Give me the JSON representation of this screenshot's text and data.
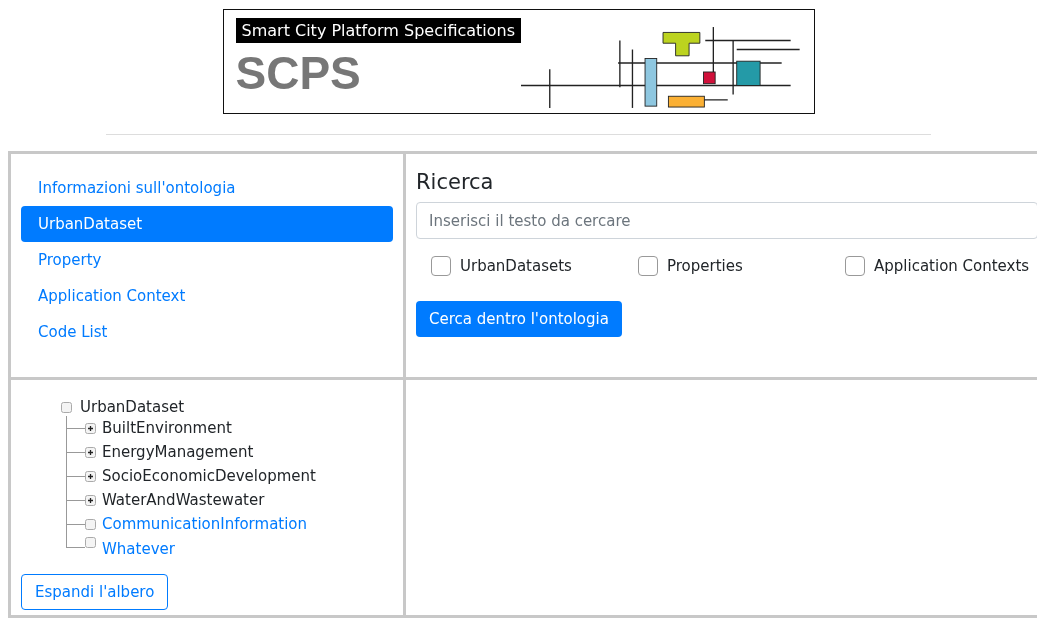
{
  "logo": {
    "title": "Smart City Platform Specifications",
    "acronym": "SCPS"
  },
  "nav": [
    {
      "label": "Informazioni sull'ontologia",
      "selected": false
    },
    {
      "label": "UrbanDataset",
      "selected": true
    },
    {
      "label": "Property",
      "selected": false
    },
    {
      "label": "Application Context",
      "selected": false
    },
    {
      "label": "Code List",
      "selected": false
    }
  ],
  "search": {
    "title": "Ricerca",
    "placeholder": "Inserisci il testo da cercare",
    "filters": [
      {
        "label": "UrbanDatasets",
        "checked": false
      },
      {
        "label": "Properties",
        "checked": false
      },
      {
        "label": "Application Contexts",
        "checked": false
      }
    ],
    "button": "Cerca dentro l'ontologia"
  },
  "tree": {
    "label": "UrbanDataset",
    "children": [
      {
        "label": "BuiltEnvironment",
        "kind": "branch"
      },
      {
        "label": "EnergyManagement",
        "kind": "branch"
      },
      {
        "label": "SocioEconomicDevelopment",
        "kind": "branch"
      },
      {
        "label": "WaterAndWastewater",
        "kind": "branch"
      },
      {
        "label": "CommunicationInformation",
        "kind": "leaf"
      },
      {
        "label": "Whatever",
        "kind": "leaf"
      }
    ]
  },
  "expand_button": "Espandi l'albero"
}
